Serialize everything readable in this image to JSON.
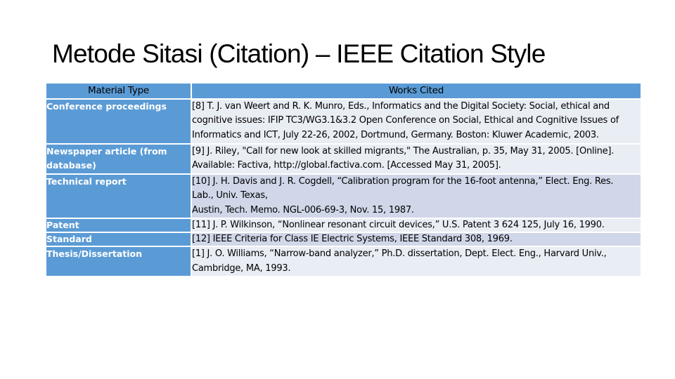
{
  "slide": {
    "title": "Metode Sitasi (Citation) – IEEE Citation Style"
  },
  "table": {
    "headers": {
      "material_type": "Material Type",
      "works_cited": "Works Cited"
    },
    "rows": [
      {
        "type": "Conference proceedings",
        "citation": "[8] T. J. van Weert and R. K. Munro, Eds., Informatics and the Digital Society: Social, ethical and cognitive issues: IFIP TC3/WG3.1&3.2 Open Conference on Social, Ethical and Cognitive Issues of Informatics and ICT, July 22-26, 2002, Dortmund, Germany. Boston: Kluwer Academic, 2003."
      },
      {
        "type": "Newspaper article (from database)",
        "citation": "[9] J. Riley, \"Call for new look at skilled migrants,\" The Australian, p. 35, May 31, 2005. [Online]. Available: Factiva, http://global.factiva.com. [Accessed May 31, 2005]."
      },
      {
        "type": "Technical report",
        "citation_lines": [
          "[10] J. H. Davis and J. R. Cogdell, “Calibration program for the 16-foot antenna,” Elect. Eng. Res.",
          "Lab., Univ. Texas,",
          "Austin, Tech. Memo. NGL-006-69-3, Nov. 15, 1987."
        ]
      },
      {
        "type": "Patent",
        "citation": "[11] J. P. Wilkinson, “Nonlinear resonant circuit devices,” U.S. Patent 3 624 125, July 16, 1990."
      },
      {
        "type": "Standard",
        "citation": "[12] IEEE Criteria for Class IE Electric Systems, IEEE Standard 308, 1969."
      },
      {
        "type": "Thesis/Dissertation",
        "citation": "[1] J. O. Williams, “Narrow-band analyzer,” Ph.D. dissertation, Dept. Elect. Eng., Harvard Univ., Cambridge, MA, 1993."
      }
    ]
  },
  "colors": {
    "header_bg": "#5b9bd5",
    "row_light": "#e9edf4",
    "row_dark": "#cfd7e8"
  }
}
